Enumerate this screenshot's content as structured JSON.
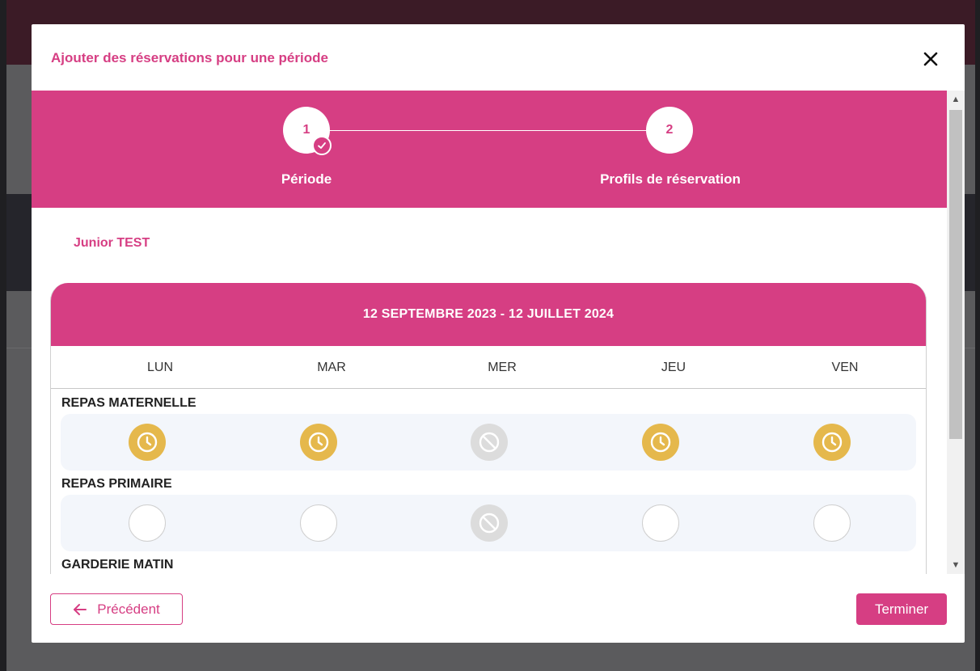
{
  "modal": {
    "title": "Ajouter des réservations pour une période"
  },
  "stepper": {
    "steps": [
      {
        "number": "1",
        "label": "Période",
        "completed": true
      },
      {
        "number": "2",
        "label": "Profils de réservation",
        "completed": false
      }
    ]
  },
  "child": {
    "name": "Junior TEST"
  },
  "calendar": {
    "period": "12 SEPTEMBRE 2023 - 12 JUILLET 2024",
    "days": [
      "LUN",
      "MAR",
      "MER",
      "JEU",
      "VEN"
    ],
    "sections": [
      {
        "title": "REPAS MATERNELLE",
        "slots": [
          "pending",
          "pending",
          "blocked",
          "pending",
          "pending"
        ]
      },
      {
        "title": "REPAS PRIMAIRE",
        "slots": [
          "empty",
          "empty",
          "blocked",
          "empty",
          "empty"
        ]
      },
      {
        "title": "GARDERIE MATIN",
        "slots": []
      }
    ]
  },
  "footer": {
    "previous_label": "Précédent",
    "finish_label": "Terminer"
  },
  "colors": {
    "accent": "#d63e83",
    "pending": "#e5b84c",
    "blocked": "#dcdcdc",
    "row_bg": "#f3f6fb"
  },
  "icons": {
    "close": "close-icon",
    "check": "check-icon",
    "pending": "clock-icon",
    "blocked": "ban-icon",
    "previous": "arrow-left-icon"
  }
}
